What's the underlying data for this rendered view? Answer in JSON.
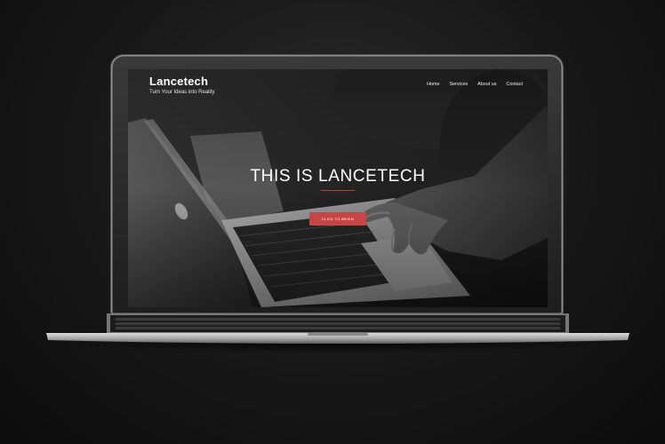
{
  "site": {
    "brand": "Lancetech",
    "tagline": "Turn Your Ideas into Reality"
  },
  "nav": {
    "items": [
      "Home",
      "Services",
      "About us",
      "Contact"
    ]
  },
  "hero": {
    "title": "THIS IS LANCETECH",
    "cta_label": "CLICK TO BEGIN"
  },
  "colors": {
    "accent": "#c64545",
    "page_background": "#1a1a1a"
  }
}
